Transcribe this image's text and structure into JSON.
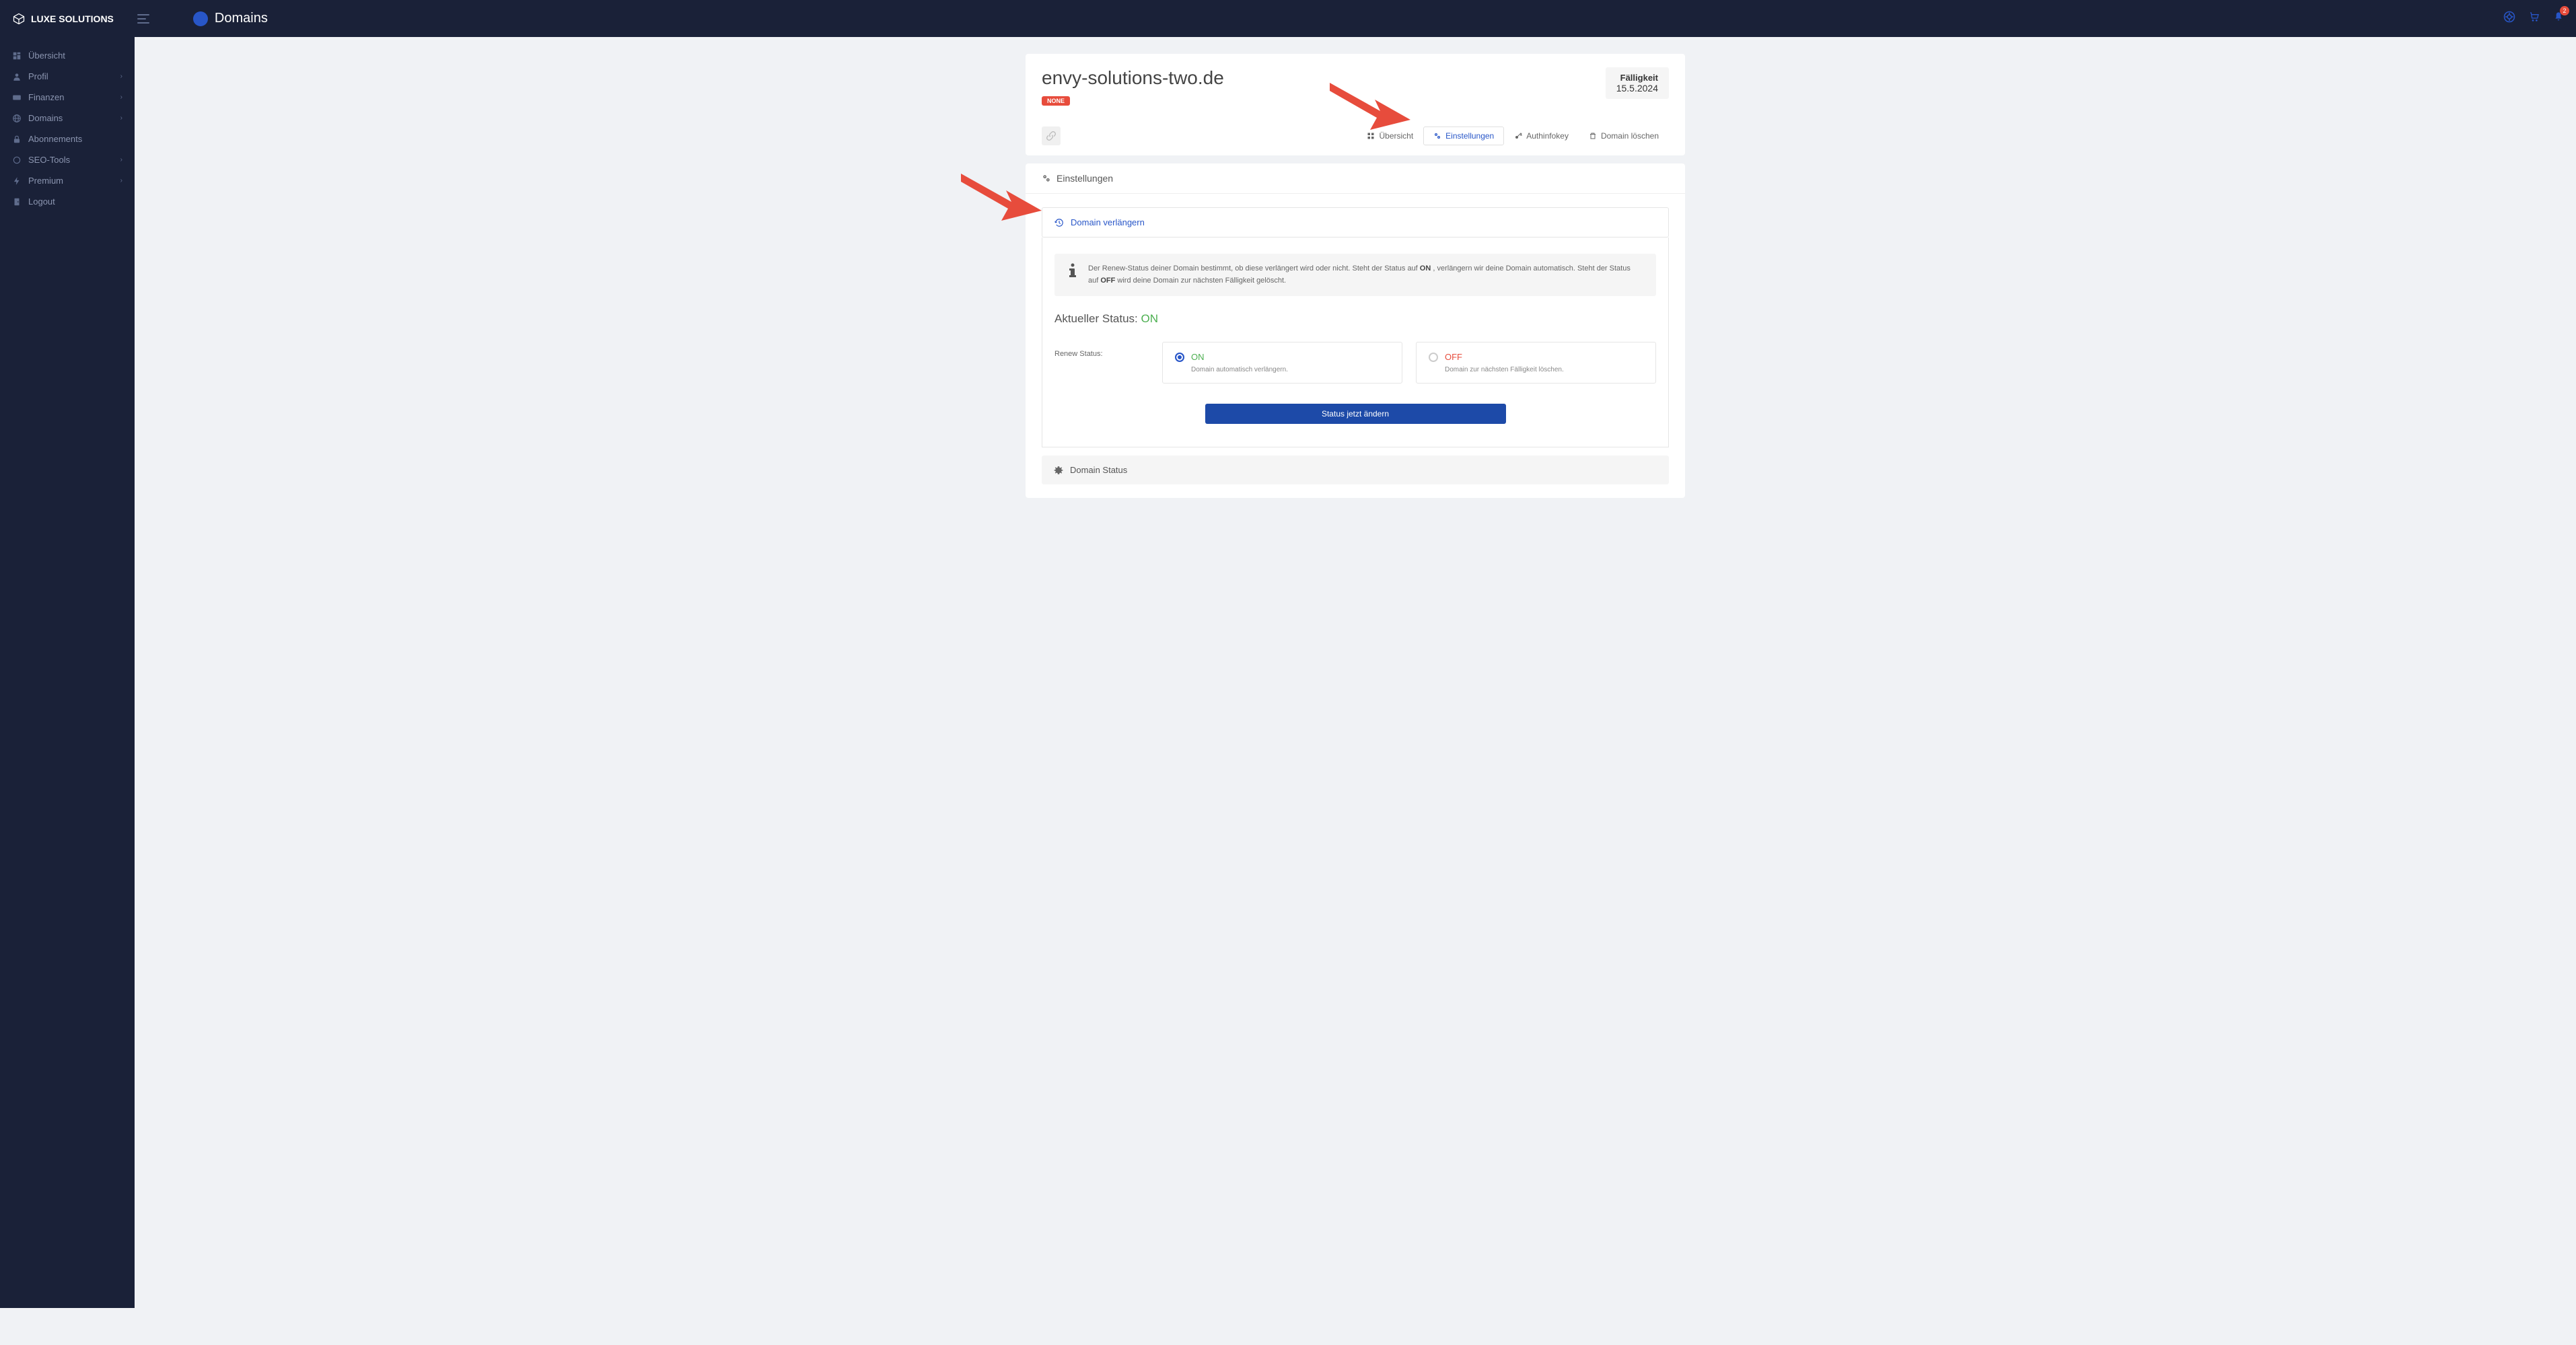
{
  "brand": {
    "name": "LUXE SOLUTIONS"
  },
  "header": {
    "title": "Domains",
    "notification_count": "2"
  },
  "sidebar": {
    "items": [
      {
        "label": "Übersicht",
        "icon": "dashboard",
        "has_chevron": false
      },
      {
        "label": "Profil",
        "icon": "user",
        "has_chevron": true
      },
      {
        "label": "Finanzen",
        "icon": "card",
        "has_chevron": true
      },
      {
        "label": "Domains",
        "icon": "globe",
        "has_chevron": true
      },
      {
        "label": "Abonnements",
        "icon": "lock",
        "has_chevron": false
      },
      {
        "label": "SEO-Tools",
        "icon": "circle",
        "has_chevron": true
      },
      {
        "label": "Premium",
        "icon": "bolt",
        "has_chevron": true
      },
      {
        "label": "Logout",
        "icon": "door",
        "has_chevron": false
      }
    ]
  },
  "domain": {
    "name": "envy-solutions-two.de",
    "badge": "NONE",
    "due_label": "Fälligkeit",
    "due_date": "15.5.2024"
  },
  "tabs": {
    "overview": "Übersicht",
    "settings": "Einstellungen",
    "authinfo": "Authinfokey",
    "delete": "Domain löschen"
  },
  "settings": {
    "header": "Einstellungen",
    "renew_section": "Domain verlängern",
    "info_text_1": "Der Renew-Status deiner Domain bestimmt, ob diese verlängert wird oder nicht. Steht der Status auf ",
    "info_on": "ON",
    "info_text_2": " , verlängern wir deine Domain automatisch. Steht der Status auf ",
    "info_off": "OFF",
    "info_text_3": " wird deine Domain zur nächsten Fälligkeit gelöscht.",
    "current_status_label": "Aktueller Status: ",
    "current_status_value": "ON",
    "renew_label": "Renew Status:",
    "option_on_title": "ON",
    "option_on_desc": "Domain automatisch verlängern.",
    "option_off_title": "OFF",
    "option_off_desc": "Domain zur nächsten Fälligkeit löschen.",
    "submit": "Status jetzt ändern",
    "domain_status_section": "Domain Status"
  }
}
